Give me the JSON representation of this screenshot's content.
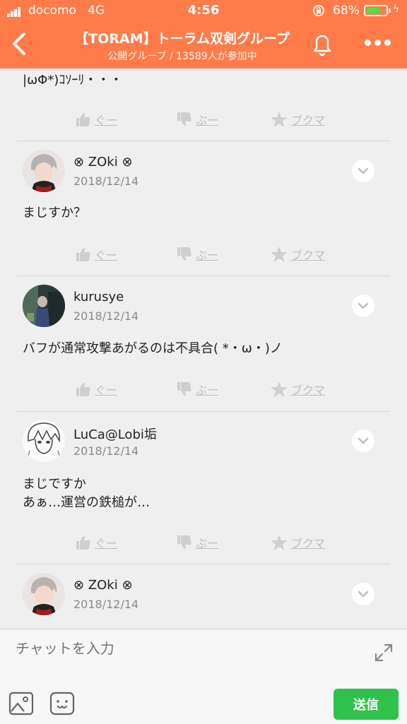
{
  "status_bar": {
    "carrier": "docomo",
    "network": "4G",
    "time": "4:56",
    "battery_percent": "68%",
    "battery_level": 0.68
  },
  "header": {
    "title": "【TORAM】トーラム双剣グループ",
    "subtitle": "公開グループ / 13589人が参加中"
  },
  "actions": {
    "like": "ぐー",
    "dislike": "ぶー",
    "bookmark": "ブクマ"
  },
  "messages": [
    {
      "text": "|ωΦ*)ｺｿｰﾘ・・・"
    },
    {
      "user": "⊗ ZOki ⊗",
      "date": "2018/12/14",
      "text": "まじすか？"
    },
    {
      "user": "kurusye",
      "date": "2018/12/14",
      "text": "バフが通常攻撃あがるのは不具合( *・ω・)ノ"
    },
    {
      "user": "LuCa@Lobi垢",
      "date": "2018/12/14",
      "text": "まじですか\nあぁ…運営の鉄槌が…"
    },
    {
      "user": "⊗ ZOki ⊗",
      "date": "2018/12/14"
    }
  ],
  "input": {
    "placeholder": "チャットを入力",
    "send_label": "送信"
  },
  "colors": {
    "header": "#ff7b4a",
    "send": "#2fc24a"
  }
}
